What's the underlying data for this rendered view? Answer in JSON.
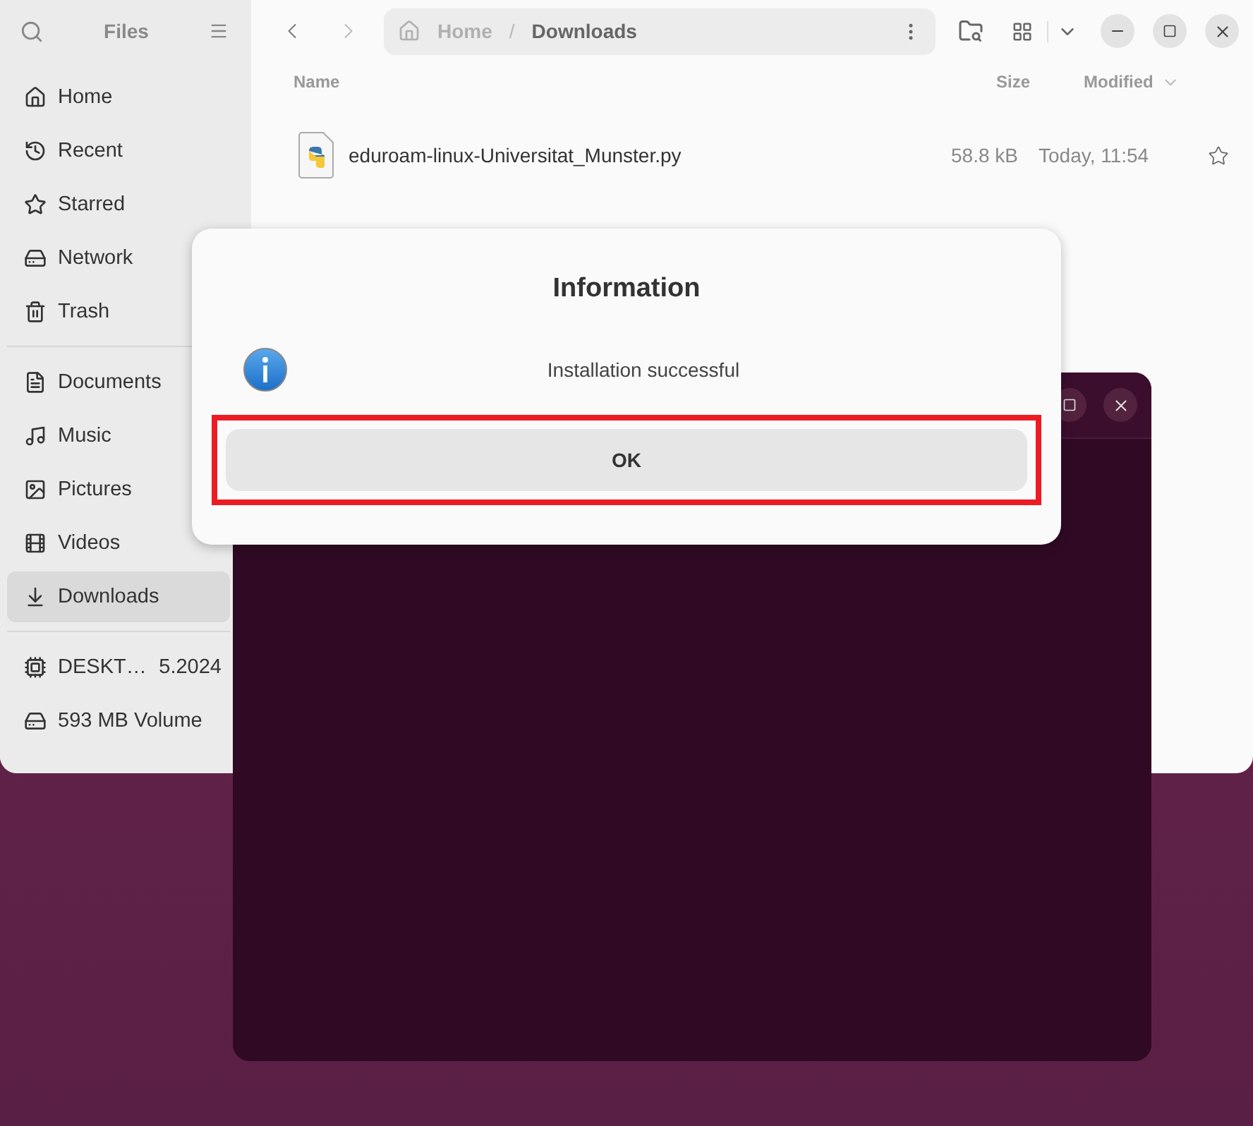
{
  "files_window": {
    "title": "Files",
    "sidebar": {
      "sections": [
        {
          "items": [
            {
              "label": "Home",
              "selected": false
            },
            {
              "label": "Recent",
              "selected": false
            },
            {
              "label": "Starred",
              "selected": false
            },
            {
              "label": "Network",
              "selected": false
            },
            {
              "label": "Trash",
              "selected": false
            }
          ]
        },
        {
          "items": [
            {
              "label": "Documents",
              "selected": false
            },
            {
              "label": "Music",
              "selected": false
            },
            {
              "label": "Pictures",
              "selected": false
            },
            {
              "label": "Videos",
              "selected": false
            },
            {
              "label": "Downloads",
              "selected": true
            }
          ]
        },
        {
          "items": [
            {
              "label": "DESKT…",
              "suffix": "5.2024",
              "selected": false
            },
            {
              "label": "593 MB Volume",
              "selected": false
            }
          ]
        }
      ]
    },
    "path": [
      "Home",
      "Downloads"
    ],
    "path_separator": "/",
    "columns": [
      "Name",
      "Size",
      "Modified"
    ],
    "rows": [
      {
        "name": "eduroam-linux-Universitat_Munster.py",
        "size": "58.8 kB",
        "modified": "Today, 11:54",
        "starred": false
      }
    ]
  },
  "dialog": {
    "title": "Information",
    "message": "Installation successful",
    "button": "OK",
    "highlighted": true
  }
}
